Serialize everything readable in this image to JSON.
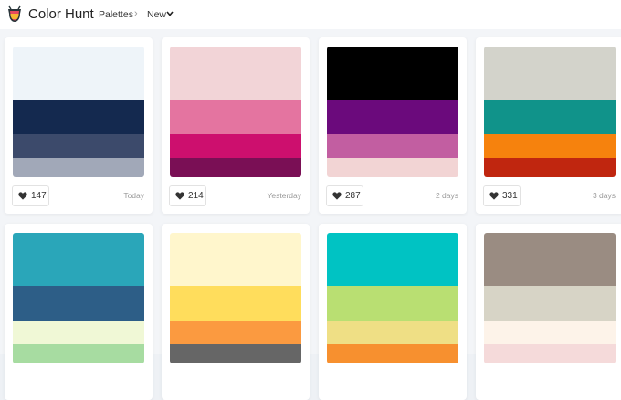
{
  "header": {
    "brand": "Color Hunt",
    "nav_palettes": "Palettes",
    "separator": "›",
    "nav_sort": "New",
    "logo_colors": [
      "#e84a5f",
      "#f7b733",
      "#2a363b"
    ]
  },
  "palettes": [
    {
      "likes": "147",
      "date": "Today",
      "colors": [
        "#eef4f9",
        "#14294f",
        "#3c4a6b",
        "#a1a8b8"
      ]
    },
    {
      "likes": "214",
      "date": "Yesterday",
      "colors": [
        "#f2d4d7",
        "#e474a0",
        "#cd0f6e",
        "#7a0f55"
      ]
    },
    {
      "likes": "287",
      "date": "2 days",
      "colors": [
        "#000000",
        "#6b0a7c",
        "#c25ea1",
        "#f2d4d4"
      ]
    },
    {
      "likes": "331",
      "date": "3 days",
      "colors": [
        "#d3d3cb",
        "#10938a",
        "#f6820d",
        "#c0260f"
      ]
    },
    {
      "likes": "",
      "date": "",
      "colors": [
        "#2aa6b9",
        "#2d5e87",
        "#f0f8d6",
        "#a7dca1"
      ]
    },
    {
      "likes": "",
      "date": "",
      "colors": [
        "#fff6cc",
        "#ffdd5c",
        "#fb9a40",
        "#666666"
      ]
    },
    {
      "likes": "",
      "date": "",
      "colors": [
        "#00c3c3",
        "#b9df72",
        "#efdf85",
        "#f7902f"
      ]
    },
    {
      "likes": "",
      "date": "",
      "colors": [
        "#9a8c82",
        "#d7d4c6",
        "#fdf3e9",
        "#f5dada"
      ]
    }
  ]
}
